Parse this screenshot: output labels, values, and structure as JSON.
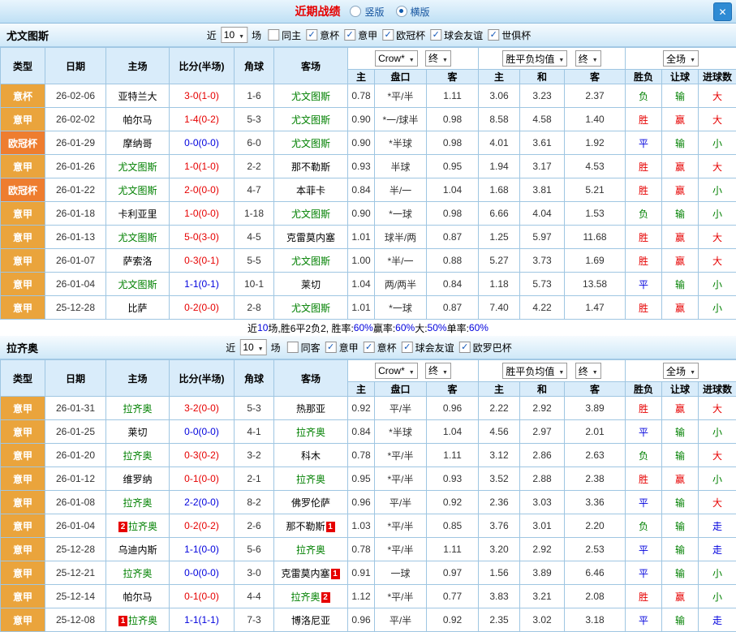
{
  "titlebar": {
    "title": "近期战绩",
    "vertical_label": "竖版",
    "horizontal_label": "横版",
    "close_glyph": "✕"
  },
  "columns": [
    "类型",
    "日期",
    "主场",
    "比分(半场)",
    "角球",
    "客场",
    "主",
    "盘口",
    "客",
    "主",
    "和",
    "客",
    "胜负",
    "让球",
    "进球数"
  ],
  "sections": [
    {
      "team": "尤文图斯",
      "near_label": "近",
      "near_value": "10",
      "games_label": "场",
      "venue_filter": {
        "label": "同主",
        "checked": false
      },
      "comps": [
        {
          "label": "意杯",
          "checked": true
        },
        {
          "label": "意甲",
          "checked": true
        },
        {
          "label": "欧冠杯",
          "checked": true
        },
        {
          "label": "球会友谊",
          "checked": true
        },
        {
          "label": "世俱杯",
          "checked": true
        }
      ],
      "selectors": {
        "company": "Crow*",
        "asia_period": "终",
        "europe_metric": "胜平负均值",
        "europe_period": "终",
        "scope": "全场"
      },
      "rows": [
        {
          "comp": {
            "t": "意杯",
            "bg": "gold"
          },
          "date": "26-02-06",
          "home": {
            "t": "亚特兰大",
            "c": "blk"
          },
          "score": {
            "t": "3-0(1-0)",
            "c": "red"
          },
          "corner": "1-6",
          "away": {
            "t": "尤文图斯",
            "c": "grn"
          },
          "asia": [
            "0.78",
            "*平/半",
            "1.11"
          ],
          "euro": [
            "3.06",
            "3.23",
            "2.37"
          ],
          "res": [
            {
              "t": "负",
              "c": "grn"
            },
            {
              "t": "输",
              "c": "grn"
            },
            {
              "t": "大",
              "c": "red"
            }
          ]
        },
        {
          "comp": {
            "t": "意甲",
            "bg": "gold"
          },
          "date": "26-02-02",
          "home": {
            "t": "帕尔马",
            "c": "blk"
          },
          "score": {
            "t": "1-4(0-2)",
            "c": "red"
          },
          "corner": "5-3",
          "away": {
            "t": "尤文图斯",
            "c": "grn"
          },
          "asia": [
            "0.90",
            "*一/球半",
            "0.98"
          ],
          "euro": [
            "8.58",
            "4.58",
            "1.40"
          ],
          "res": [
            {
              "t": "胜",
              "c": "red"
            },
            {
              "t": "赢",
              "c": "red"
            },
            {
              "t": "大",
              "c": "red"
            }
          ]
        },
        {
          "comp": {
            "t": "欧冠杯",
            "bg": "orange"
          },
          "date": "26-01-29",
          "home": {
            "t": "摩纳哥",
            "c": "blk"
          },
          "score": {
            "t": "0-0(0-0)",
            "c": "blu"
          },
          "corner": "6-0",
          "away": {
            "t": "尤文图斯",
            "c": "grn"
          },
          "asia": [
            "0.90",
            "*半球",
            "0.98"
          ],
          "euro": [
            "4.01",
            "3.61",
            "1.92"
          ],
          "res": [
            {
              "t": "平",
              "c": "blu"
            },
            {
              "t": "输",
              "c": "grn"
            },
            {
              "t": "小",
              "c": "grn"
            }
          ]
        },
        {
          "comp": {
            "t": "意甲",
            "bg": "gold"
          },
          "date": "26-01-26",
          "home": {
            "t": "尤文图斯",
            "c": "grn"
          },
          "score": {
            "t": "1-0(1-0)",
            "c": "red"
          },
          "corner": "2-2",
          "away": {
            "t": "那不勒斯",
            "c": "blk"
          },
          "asia": [
            "0.93",
            "半球",
            "0.95"
          ],
          "euro": [
            "1.94",
            "3.17",
            "4.53"
          ],
          "res": [
            {
              "t": "胜",
              "c": "red"
            },
            {
              "t": "赢",
              "c": "red"
            },
            {
              "t": "大",
              "c": "red"
            }
          ]
        },
        {
          "comp": {
            "t": "欧冠杯",
            "bg": "orange"
          },
          "date": "26-01-22",
          "home": {
            "t": "尤文图斯",
            "c": "grn"
          },
          "score": {
            "t": "2-0(0-0)",
            "c": "red"
          },
          "corner": "4-7",
          "away": {
            "t": "本菲卡",
            "c": "blk"
          },
          "asia": [
            "0.84",
            "半/一",
            "1.04"
          ],
          "euro": [
            "1.68",
            "3.81",
            "5.21"
          ],
          "res": [
            {
              "t": "胜",
              "c": "red"
            },
            {
              "t": "赢",
              "c": "red"
            },
            {
              "t": "小",
              "c": "grn"
            }
          ]
        },
        {
          "comp": {
            "t": "意甲",
            "bg": "gold"
          },
          "date": "26-01-18",
          "home": {
            "t": "卡利亚里",
            "c": "blk"
          },
          "score": {
            "t": "1-0(0-0)",
            "c": "red"
          },
          "corner": "1-18",
          "away": {
            "t": "尤文图斯",
            "c": "grn"
          },
          "asia": [
            "0.90",
            "*一球",
            "0.98"
          ],
          "euro": [
            "6.66",
            "4.04",
            "1.53"
          ],
          "res": [
            {
              "t": "负",
              "c": "grn"
            },
            {
              "t": "输",
              "c": "grn"
            },
            {
              "t": "小",
              "c": "grn"
            }
          ]
        },
        {
          "comp": {
            "t": "意甲",
            "bg": "gold"
          },
          "date": "26-01-13",
          "home": {
            "t": "尤文图斯",
            "c": "grn"
          },
          "score": {
            "t": "5-0(3-0)",
            "c": "red"
          },
          "corner": "4-5",
          "away": {
            "t": "克雷莫内塞",
            "c": "blk"
          },
          "asia": [
            "1.01",
            "球半/两",
            "0.87"
          ],
          "euro": [
            "1.25",
            "5.97",
            "11.68"
          ],
          "res": [
            {
              "t": "胜",
              "c": "red"
            },
            {
              "t": "赢",
              "c": "red"
            },
            {
              "t": "大",
              "c": "red"
            }
          ]
        },
        {
          "comp": {
            "t": "意甲",
            "bg": "gold"
          },
          "date": "26-01-07",
          "home": {
            "t": "萨索洛",
            "c": "blk"
          },
          "score": {
            "t": "0-3(0-1)",
            "c": "red"
          },
          "corner": "5-5",
          "away": {
            "t": "尤文图斯",
            "c": "grn"
          },
          "asia": [
            "1.00",
            "*半/一",
            "0.88"
          ],
          "euro": [
            "5.27",
            "3.73",
            "1.69"
          ],
          "res": [
            {
              "t": "胜",
              "c": "red"
            },
            {
              "t": "赢",
              "c": "red"
            },
            {
              "t": "大",
              "c": "red"
            }
          ]
        },
        {
          "comp": {
            "t": "意甲",
            "bg": "gold"
          },
          "date": "26-01-04",
          "home": {
            "t": "尤文图斯",
            "c": "grn"
          },
          "score": {
            "t": "1-1(0-1)",
            "c": "blu"
          },
          "corner": "10-1",
          "away": {
            "t": "莱切",
            "c": "blk"
          },
          "asia": [
            "1.04",
            "两/两半",
            "0.84"
          ],
          "euro": [
            "1.18",
            "5.73",
            "13.58"
          ],
          "res": [
            {
              "t": "平",
              "c": "blu"
            },
            {
              "t": "输",
              "c": "grn"
            },
            {
              "t": "小",
              "c": "grn"
            }
          ]
        },
        {
          "comp": {
            "t": "意甲",
            "bg": "gold"
          },
          "date": "25-12-28",
          "home": {
            "t": "比萨",
            "c": "blk"
          },
          "score": {
            "t": "0-2(0-0)",
            "c": "red"
          },
          "corner": "2-8",
          "away": {
            "t": "尤文图斯",
            "c": "grn"
          },
          "asia": [
            "1.01",
            "*一球",
            "0.87"
          ],
          "euro": [
            "7.40",
            "4.22",
            "1.47"
          ],
          "res": [
            {
              "t": "胜",
              "c": "red"
            },
            {
              "t": "赢",
              "c": "red"
            },
            {
              "t": "小",
              "c": "grn"
            }
          ]
        }
      ],
      "summary": [
        {
          "t": "近",
          "c": "blk"
        },
        {
          "t": "10",
          "c": "blu"
        },
        {
          "t": "场,胜6平2负2, 胜率:",
          "c": "blk"
        },
        {
          "t": "60%",
          "c": "blu"
        },
        {
          "t": " 赢率:",
          "c": "blk"
        },
        {
          "t": "60%",
          "c": "blu"
        },
        {
          "t": " 大:",
          "c": "blk"
        },
        {
          "t": "50%",
          "c": "blu"
        },
        {
          "t": " 单率:",
          "c": "blk"
        },
        {
          "t": "60%",
          "c": "blu"
        }
      ]
    },
    {
      "team": "拉齐奥",
      "near_label": "近",
      "near_value": "10",
      "games_label": "场",
      "venue_filter": {
        "label": "同客",
        "checked": false
      },
      "comps": [
        {
          "label": "意甲",
          "checked": true
        },
        {
          "label": "意杯",
          "checked": true
        },
        {
          "label": "球会友谊",
          "checked": true
        },
        {
          "label": "欧罗巴杯",
          "checked": true
        }
      ],
      "selectors": {
        "company": "Crow*",
        "asia_period": "终",
        "europe_metric": "胜平负均值",
        "europe_period": "终",
        "scope": "全场"
      },
      "rows": [
        {
          "comp": {
            "t": "意甲",
            "bg": "gold"
          },
          "date": "26-01-31",
          "home": {
            "t": "拉齐奥",
            "c": "grn"
          },
          "score": {
            "t": "3-2(0-0)",
            "c": "red"
          },
          "corner": "5-3",
          "away": {
            "t": "热那亚",
            "c": "blk"
          },
          "asia": [
            "0.92",
            "平/半",
            "0.96"
          ],
          "euro": [
            "2.22",
            "2.92",
            "3.89"
          ],
          "res": [
            {
              "t": "胜",
              "c": "red"
            },
            {
              "t": "赢",
              "c": "red"
            },
            {
              "t": "大",
              "c": "red"
            }
          ]
        },
        {
          "comp": {
            "t": "意甲",
            "bg": "gold"
          },
          "date": "26-01-25",
          "home": {
            "t": "莱切",
            "c": "blk"
          },
          "score": {
            "t": "0-0(0-0)",
            "c": "blu"
          },
          "corner": "4-1",
          "away": {
            "t": "拉齐奥",
            "c": "grn"
          },
          "asia": [
            "0.84",
            "*半球",
            "1.04"
          ],
          "euro": [
            "4.56",
            "2.97",
            "2.01"
          ],
          "res": [
            {
              "t": "平",
              "c": "blu"
            },
            {
              "t": "输",
              "c": "grn"
            },
            {
              "t": "小",
              "c": "grn"
            }
          ]
        },
        {
          "comp": {
            "t": "意甲",
            "bg": "gold"
          },
          "date": "26-01-20",
          "home": {
            "t": "拉齐奥",
            "c": "grn"
          },
          "score": {
            "t": "0-3(0-2)",
            "c": "red"
          },
          "corner": "3-2",
          "away": {
            "t": "科木",
            "c": "blk"
          },
          "asia": [
            "0.78",
            "*平/半",
            "1.11"
          ],
          "euro": [
            "3.12",
            "2.86",
            "2.63"
          ],
          "res": [
            {
              "t": "负",
              "c": "grn"
            },
            {
              "t": "输",
              "c": "grn"
            },
            {
              "t": "大",
              "c": "red"
            }
          ]
        },
        {
          "comp": {
            "t": "意甲",
            "bg": "gold"
          },
          "date": "26-01-12",
          "home": {
            "t": "维罗纳",
            "c": "blk"
          },
          "score": {
            "t": "0-1(0-0)",
            "c": "red"
          },
          "corner": "2-1",
          "away": {
            "t": "拉齐奥",
            "c": "grn"
          },
          "asia": [
            "0.95",
            "*平/半",
            "0.93"
          ],
          "euro": [
            "3.52",
            "2.88",
            "2.38"
          ],
          "res": [
            {
              "t": "胜",
              "c": "red"
            },
            {
              "t": "赢",
              "c": "red"
            },
            {
              "t": "小",
              "c": "grn"
            }
          ]
        },
        {
          "comp": {
            "t": "意甲",
            "bg": "gold"
          },
          "date": "26-01-08",
          "home": {
            "t": "拉齐奥",
            "c": "grn"
          },
          "score": {
            "t": "2-2(0-0)",
            "c": "blu"
          },
          "corner": "8-2",
          "away": {
            "t": "佛罗伦萨",
            "c": "blk"
          },
          "asia": [
            "0.96",
            "平/半",
            "0.92"
          ],
          "euro": [
            "2.36",
            "3.03",
            "3.36"
          ],
          "res": [
            {
              "t": "平",
              "c": "blu"
            },
            {
              "t": "输",
              "c": "grn"
            },
            {
              "t": "大",
              "c": "red"
            }
          ]
        },
        {
          "comp": {
            "t": "意甲",
            "bg": "gold"
          },
          "date": "26-01-04",
          "home": {
            "t": "拉齐奥",
            "c": "grn",
            "rb": "2",
            "rbpos": "before"
          },
          "score": {
            "t": "0-2(0-2)",
            "c": "red"
          },
          "corner": "2-6",
          "away": {
            "t": "那不勒斯",
            "c": "blk",
            "rb": "1",
            "rbpos": "after"
          },
          "asia": [
            "1.03",
            "*平/半",
            "0.85"
          ],
          "euro": [
            "3.76",
            "3.01",
            "2.20"
          ],
          "res": [
            {
              "t": "负",
              "c": "grn"
            },
            {
              "t": "输",
              "c": "grn"
            },
            {
              "t": "走",
              "c": "blu"
            }
          ]
        },
        {
          "comp": {
            "t": "意甲",
            "bg": "gold"
          },
          "date": "25-12-28",
          "home": {
            "t": "乌迪内斯",
            "c": "blk"
          },
          "score": {
            "t": "1-1(0-0)",
            "c": "blu"
          },
          "corner": "5-6",
          "away": {
            "t": "拉齐奥",
            "c": "grn"
          },
          "asia": [
            "0.78",
            "*平/半",
            "1.11"
          ],
          "euro": [
            "3.20",
            "2.92",
            "2.53"
          ],
          "res": [
            {
              "t": "平",
              "c": "blu"
            },
            {
              "t": "输",
              "c": "grn"
            },
            {
              "t": "走",
              "c": "blu"
            }
          ]
        },
        {
          "comp": {
            "t": "意甲",
            "bg": "gold"
          },
          "date": "25-12-21",
          "home": {
            "t": "拉齐奥",
            "c": "grn"
          },
          "score": {
            "t": "0-0(0-0)",
            "c": "blu"
          },
          "corner": "3-0",
          "away": {
            "t": "克雷莫内塞",
            "c": "blk",
            "rb": "1",
            "rbpos": "after"
          },
          "asia": [
            "0.91",
            "一球",
            "0.97"
          ],
          "euro": [
            "1.56",
            "3.89",
            "6.46"
          ],
          "res": [
            {
              "t": "平",
              "c": "blu"
            },
            {
              "t": "输",
              "c": "grn"
            },
            {
              "t": "小",
              "c": "grn"
            }
          ]
        },
        {
          "comp": {
            "t": "意甲",
            "bg": "gold"
          },
          "date": "25-12-14",
          "home": {
            "t": "帕尔马",
            "c": "blk"
          },
          "score": {
            "t": "0-1(0-0)",
            "c": "red"
          },
          "corner": "4-4",
          "away": {
            "t": "拉齐奥",
            "c": "grn",
            "rb": "2",
            "rbpos": "after"
          },
          "asia": [
            "1.12",
            "*平/半",
            "0.77"
          ],
          "euro": [
            "3.83",
            "3.21",
            "2.08"
          ],
          "res": [
            {
              "t": "胜",
              "c": "red"
            },
            {
              "t": "赢",
              "c": "red"
            },
            {
              "t": "小",
              "c": "grn"
            }
          ]
        },
        {
          "comp": {
            "t": "意甲",
            "bg": "gold"
          },
          "date": "25-12-08",
          "home": {
            "t": "拉齐奥",
            "c": "grn",
            "rb": "1",
            "rbpos": "before"
          },
          "score": {
            "t": "1-1(1-1)",
            "c": "blu"
          },
          "corner": "7-3",
          "away": {
            "t": "博洛尼亚",
            "c": "blk"
          },
          "asia": [
            "0.96",
            "平/半",
            "0.92"
          ],
          "euro": [
            "2.35",
            "3.02",
            "3.18"
          ],
          "res": [
            {
              "t": "平",
              "c": "blu"
            },
            {
              "t": "输",
              "c": "grn"
            },
            {
              "t": "走",
              "c": "blu"
            }
          ]
        }
      ],
      "summary": []
    }
  ]
}
